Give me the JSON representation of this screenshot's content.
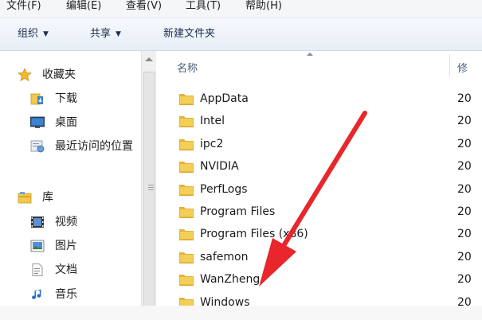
{
  "menu": [
    "文件(F)",
    "编辑(E)",
    "查看(V)",
    "工具(T)",
    "帮助(H)"
  ],
  "toolbar": {
    "organize": "组织",
    "share": "共享",
    "new_folder": "新建文件夹"
  },
  "nav": {
    "favorites": {
      "label": "收藏夹",
      "items": [
        "下载",
        "桌面",
        "最近访问的位置"
      ]
    },
    "libraries": {
      "label": "库",
      "items": [
        "视频",
        "图片",
        "文档",
        "音乐"
      ]
    }
  },
  "columns": {
    "name": "名称",
    "modified_partial": "修"
  },
  "files": [
    {
      "name": "AppData",
      "date": "20"
    },
    {
      "name": "Intel",
      "date": "20"
    },
    {
      "name": "ipc2",
      "date": "20"
    },
    {
      "name": "NVIDIA",
      "date": "20"
    },
    {
      "name": "PerfLogs",
      "date": "20"
    },
    {
      "name": "Program Files",
      "date": "20"
    },
    {
      "name": "Program Files (x86)",
      "date": "20"
    },
    {
      "name": "safemon",
      "date": "20"
    },
    {
      "name": "WanZheng",
      "date": "20"
    },
    {
      "name": "Windows",
      "date": "20"
    }
  ],
  "colors": {
    "arrow": "#e8262b",
    "folder": "#f0c34c"
  },
  "icons": [
    "star-icon",
    "download-folder-icon",
    "desktop-icon",
    "recent-places-icon",
    "library-icon",
    "video-icon",
    "picture-icon",
    "document-icon",
    "music-icon",
    "folder-icon",
    "annotation-arrow-icon"
  ]
}
